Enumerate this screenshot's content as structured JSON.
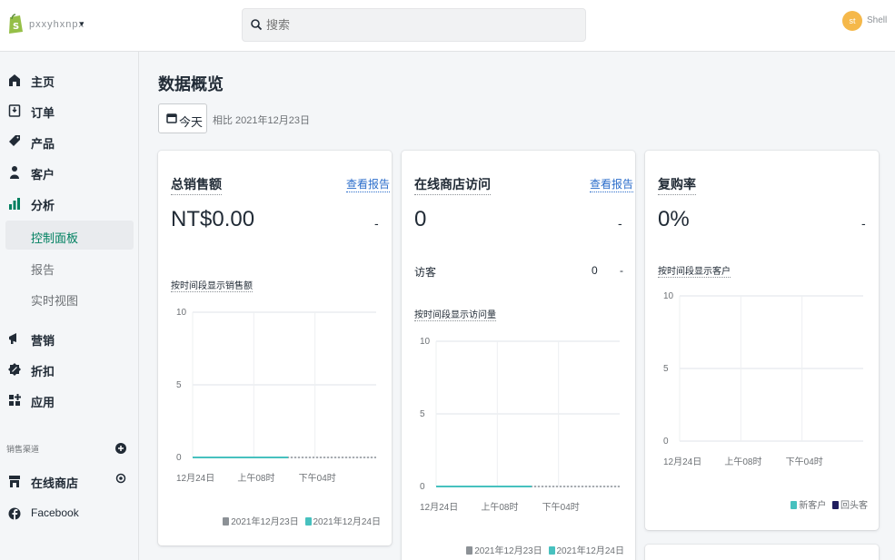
{
  "topbar": {
    "store_name": "pxxyhxnpx",
    "search_placeholder": "搜索",
    "avatar_initial": "st",
    "user_name": "Shell"
  },
  "sidebar": {
    "items": [
      {
        "label": "主页",
        "icon": "home-icon"
      },
      {
        "label": "订单",
        "icon": "orders-icon"
      },
      {
        "label": "产品",
        "icon": "tag-icon"
      },
      {
        "label": "客户",
        "icon": "person-icon"
      },
      {
        "label": "分析",
        "icon": "bar-chart-icon"
      }
    ],
    "analytics_sub": [
      {
        "label": "控制面板",
        "active": true
      },
      {
        "label": "报告",
        "active": false
      },
      {
        "label": "实时视图",
        "active": false
      }
    ],
    "items2": [
      {
        "label": "营销",
        "icon": "megaphone-icon"
      },
      {
        "label": "折扣",
        "icon": "discount-icon"
      },
      {
        "label": "应用",
        "icon": "apps-icon"
      }
    ],
    "channels_heading": "销售渠道",
    "channels": [
      {
        "label": "在线商店",
        "icon": "store-icon"
      },
      {
        "label": "Facebook",
        "icon": "facebook-icon"
      }
    ]
  },
  "main": {
    "title": "数据概览",
    "date_button": "今天",
    "compare_text": "相比 2021年12月23日"
  },
  "cards": {
    "sales": {
      "title": "总销售额",
      "link": "查看报告",
      "value": "NT$0.00",
      "dash": "-",
      "chart_title": "按时间段显示销售额",
      "legend_a": "2021年12月23日",
      "legend_b": "2021年12月24日"
    },
    "visits": {
      "title": "在线商店访问",
      "link": "查看报告",
      "value": "0",
      "dash": "-",
      "visitor_label": "访客",
      "visitor_value": "0",
      "visitor_dash": "-",
      "chart_title": "按时间段显示访问量",
      "legend_a": "2021年12月23日",
      "legend_b": "2021年12月24日"
    },
    "repeat": {
      "title": "复购率",
      "value": "0%",
      "dash": "-",
      "chart_title": "按时间段显示客户",
      "legend_a": "新客户",
      "legend_b": "回头客"
    }
  },
  "colors": {
    "teal": "#47c1bf",
    "gray_series": "#8c9196",
    "navy": "#1f1d5e",
    "link": "#2c6ecb",
    "brand": "#95bf47"
  },
  "chart_data": [
    {
      "type": "line",
      "title": "按时间段显示销售额",
      "categories": [
        "12月24日",
        "上午08时",
        "下午04时"
      ],
      "ylim": [
        0,
        10
      ],
      "yticks": [
        "10",
        "5",
        "0"
      ],
      "series": [
        {
          "name": "2021年12月23日",
          "values": [
            0,
            0,
            0
          ]
        },
        {
          "name": "2021年12月24日",
          "values": [
            0,
            0,
            0
          ]
        }
      ],
      "legend": "bottom-right",
      "grid": true
    },
    {
      "type": "line",
      "title": "按时间段显示访问量",
      "categories": [
        "12月24日",
        "上午08时",
        "下午04时"
      ],
      "ylim": [
        0,
        10
      ],
      "yticks": [
        "10",
        "5",
        "0"
      ],
      "series": [
        {
          "name": "2021年12月23日",
          "values": [
            0,
            0,
            0
          ]
        },
        {
          "name": "2021年12月24日",
          "values": [
            0,
            0,
            0
          ]
        }
      ],
      "legend": "bottom-right",
      "grid": true
    },
    {
      "type": "bar",
      "title": "按时间段显示客户",
      "categories": [
        "12月24日",
        "上午08时",
        "下午04时"
      ],
      "ylim": [
        0,
        10
      ],
      "yticks": [
        "10",
        "5",
        "0"
      ],
      "series": [
        {
          "name": "新客户",
          "values": [
            0,
            0,
            0
          ]
        },
        {
          "name": "回头客",
          "values": [
            0,
            0,
            0
          ]
        }
      ],
      "legend": "bottom-right",
      "grid": true
    }
  ]
}
